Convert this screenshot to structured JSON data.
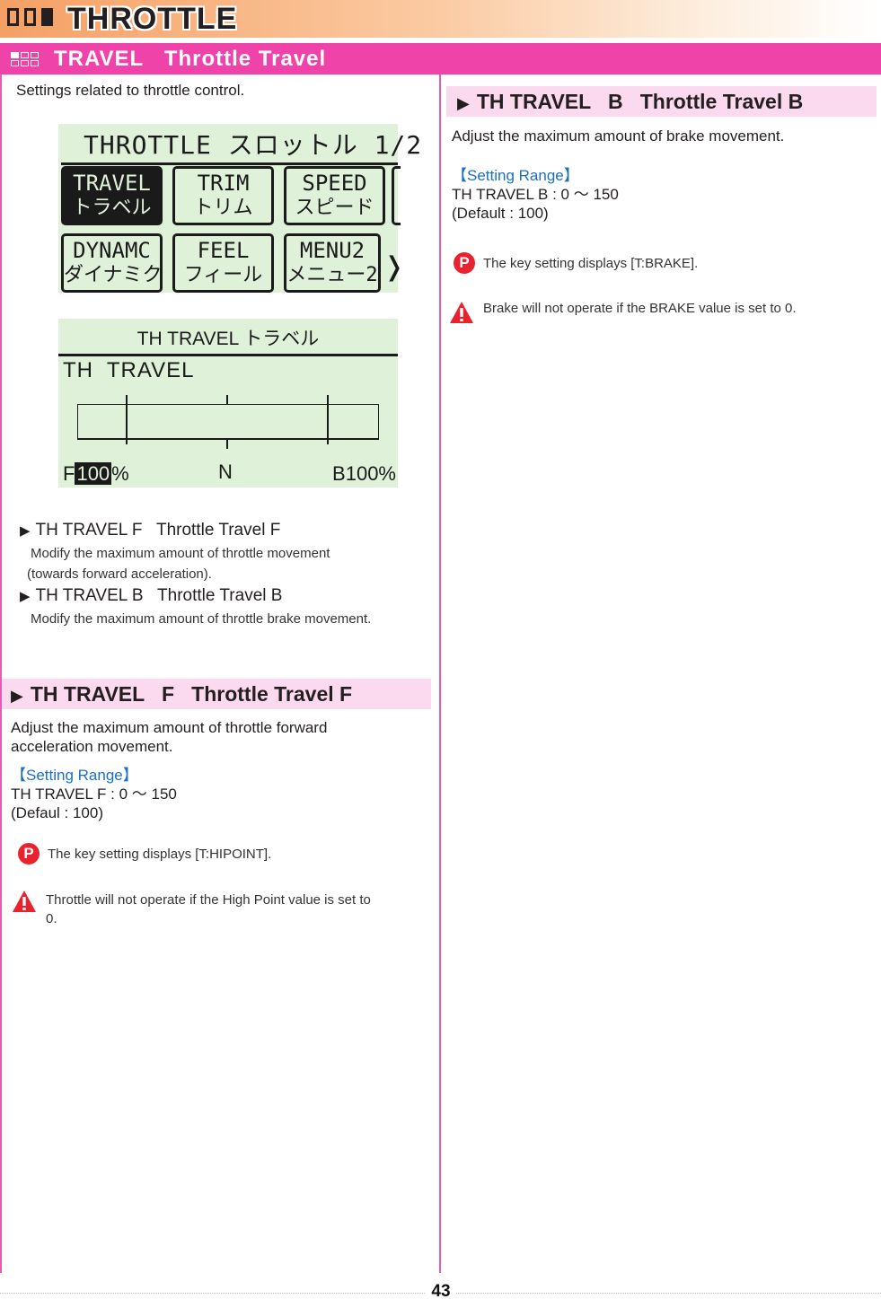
{
  "chapter": {
    "title": "THROTTLE",
    "squares": [
      "outline",
      "outline",
      "filled"
    ]
  },
  "section": {
    "title": "TRAVEL   Throttle Travel",
    "grid": [
      "filled",
      "outline",
      "outline",
      "outline",
      "outline",
      "outline"
    ]
  },
  "intro": "Settings related to throttle control.",
  "lcd_menu": {
    "title": "THROTTLE スロットル 1/2",
    "buttons": [
      {
        "line1": "TRAVEL",
        "line2": "トラベル",
        "selected": true
      },
      {
        "line1": "TRIM",
        "line2": "トリム",
        "selected": false
      },
      {
        "line1": "SPEED",
        "line2": "スピード",
        "selected": false
      },
      {
        "line1": "DYNAMC",
        "line2": "ダイナミク",
        "selected": false
      },
      {
        "line1": "FEEL",
        "line2": "フィール",
        "selected": false
      },
      {
        "line1": "MENU2",
        "line2": "メニュー2",
        "selected": false
      }
    ],
    "arrow": "❭"
  },
  "lcd_travel": {
    "title": "TH TRAVEL トラベル",
    "label": "TH  TRAVEL",
    "f_prefix": "F",
    "f_value": "100",
    "f_suffix": "%",
    "neutral": "N",
    "b_label": "B100%",
    "travel_f_percent": 100,
    "travel_b_percent": 100
  },
  "bullets": [
    {
      "heading": "TH TRAVEL F   Throttle Travel F",
      "desc1": "Modify the maximum amount of throttle movement",
      "desc2": "(towards forward acceleration)."
    },
    {
      "heading": "TH TRAVEL B   Throttle Travel B",
      "desc1": "Modify the maximum amount of throttle brake movement.",
      "desc2": ""
    }
  ],
  "travel_f": {
    "heading": "TH TRAVEL   F   Throttle Travel F",
    "desc_line1": "Adjust the maximum amount of throttle forward",
    "desc_line2": "acceleration movement.",
    "range_title": "【Setting Range】",
    "range": "TH TRAVEL F : 0 〜 150",
    "default": "(Defaul : 100)",
    "point_note": "The key setting displays [T:HIPOINT].",
    "warning_line1": "Throttle will not operate if the High Point value is set to",
    "warning_line2": "0."
  },
  "travel_b": {
    "heading": "TH TRAVEL   B   Throttle Travel B",
    "desc": "Adjust the maximum amount of brake movement.",
    "range_title": "【Setting Range】",
    "range": "TH TRAVEL B : 0 〜 150",
    "default": "(Default : 100)",
    "point_note": "The key setting displays [T:BRAKE].",
    "warning": "Brake will not operate if the BRAKE value is set to 0."
  },
  "icons": {
    "point": "P",
    "bullet": "▶"
  },
  "colors": {
    "accent_pink": "#f043aa",
    "sub_header_pink": "#fbd9ee",
    "lcd_green": "#e0f1da",
    "range_blue": "#1d6fc0",
    "alert_red": "#e8232f"
  },
  "page_number": "43"
}
